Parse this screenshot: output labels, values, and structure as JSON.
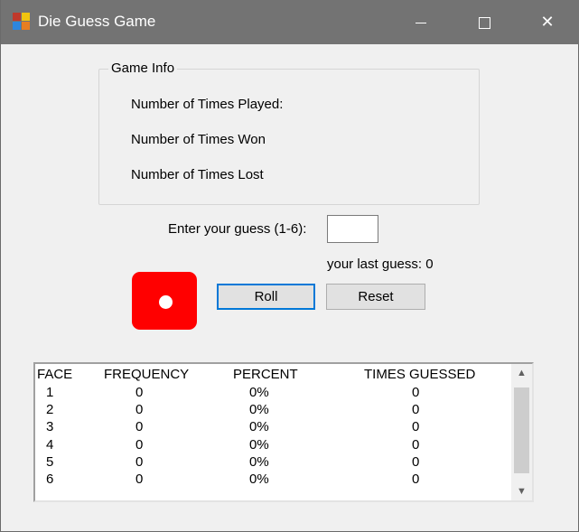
{
  "window": {
    "title": "Die Guess Game",
    "icon": "app-icon"
  },
  "game_info": {
    "legend": "Game Info",
    "times_played_label": "Number of Times Played:",
    "times_won_label": "Number of Times Won",
    "times_lost_label": "Number of Times Lost"
  },
  "guess": {
    "label": "Enter your guess (1-6):",
    "value": "",
    "last_guess_text": "your last guess: 0"
  },
  "die": {
    "face": 1,
    "color": "#ff0000"
  },
  "buttons": {
    "roll": "Roll",
    "reset": "Reset"
  },
  "stats": {
    "headers": [
      "FACE",
      "FREQUENCY",
      "PERCENT",
      "TIMES GUESSED"
    ],
    "rows": [
      [
        "1",
        "0",
        "0%",
        "0"
      ],
      [
        "2",
        "0",
        "0%",
        "0"
      ],
      [
        "3",
        "0",
        "0%",
        "0"
      ],
      [
        "4",
        "0",
        "0%",
        "0"
      ],
      [
        "5",
        "0",
        "0%",
        "0"
      ],
      [
        "6",
        "0",
        "0%",
        "0"
      ]
    ]
  }
}
